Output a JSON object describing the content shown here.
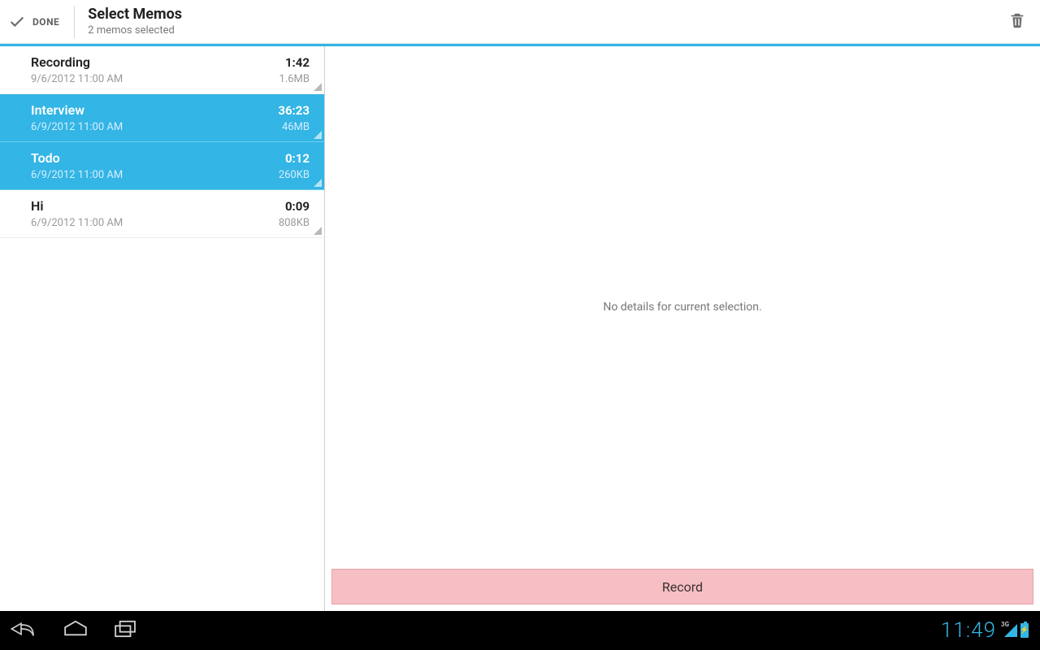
{
  "actionbar": {
    "done_label": "DONE",
    "title": "Select Memos",
    "subtitle": "2 memos selected"
  },
  "memos": [
    {
      "title": "Recording",
      "duration": "1:42",
      "date": "9/6/2012 11:00 AM",
      "size": "1.6MB",
      "selected": false
    },
    {
      "title": "Interview",
      "duration": "36:23",
      "date": "6/9/2012 11:00 AM",
      "size": "46MB",
      "selected": true
    },
    {
      "title": "Todo",
      "duration": "0:12",
      "date": "6/9/2012 11:00 AM",
      "size": "260KB",
      "selected": true
    },
    {
      "title": "Hi",
      "duration": "0:09",
      "date": "6/9/2012 11:00 AM",
      "size": "808KB",
      "selected": false
    }
  ],
  "detail": {
    "empty_message": "No details for current selection.",
    "record_label": "Record"
  },
  "system": {
    "clock": "11:49",
    "network_label": "3G"
  }
}
